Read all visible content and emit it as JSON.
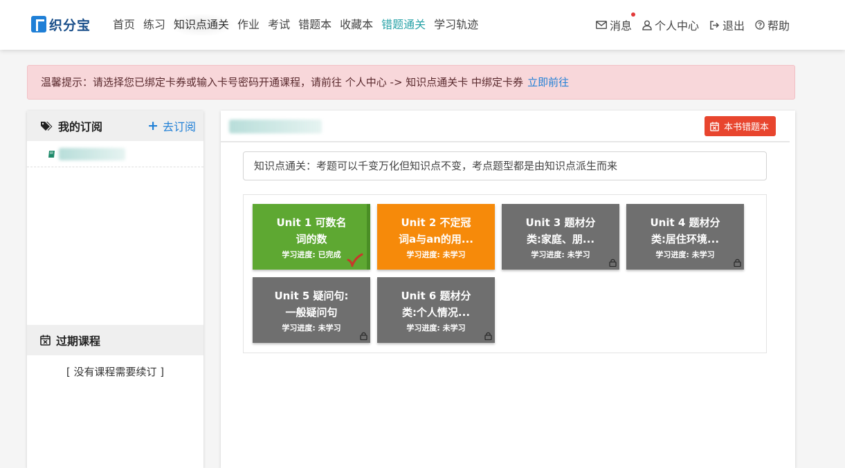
{
  "brand": {
    "name": "织分宝",
    "color": "#1f7fd6"
  },
  "nav": {
    "items": [
      {
        "label": "首页",
        "state": "normal"
      },
      {
        "label": "练习",
        "state": "normal"
      },
      {
        "label": "知识点通关",
        "state": "active"
      },
      {
        "label": "作业",
        "state": "normal"
      },
      {
        "label": "考试",
        "state": "normal"
      },
      {
        "label": "错题本",
        "state": "normal"
      },
      {
        "label": "收藏本",
        "state": "normal"
      },
      {
        "label": "错题通关",
        "state": "teal"
      },
      {
        "label": "学习轨迹",
        "state": "normal"
      }
    ],
    "right": {
      "messages": "消息",
      "profile": "个人中心",
      "logout": "退出",
      "help": "帮助"
    }
  },
  "alert": {
    "text": "温馨提示：请选择您已绑定卡券或输入卡号密码开通课程，请前往 个人中心 -> 知识点通关卡 中绑定卡券",
    "link": "立即前往"
  },
  "sidebar": {
    "subscriptions_title": "我的订阅",
    "subscribe_link": "去订阅",
    "expired_title": "过期课程",
    "expired_empty": "[ 没有课程需要续订 ]"
  },
  "main": {
    "error_book_button": "本书错题本",
    "info": "知识点通关：考题可以千变万化但知识点不变，考点题型都是由知识点派生而来",
    "units": [
      {
        "title_line1": "Unit 1 可数名",
        "title_line2": "词的数",
        "progress": "学习进度: 已完成",
        "status": "done"
      },
      {
        "title_line1": "Unit 2 不定冠",
        "title_line2": "词a与an的用...",
        "progress": "学习进度: 未学习",
        "status": "current"
      },
      {
        "title_line1": "Unit 3 题材分",
        "title_line2": "类:家庭、朋...",
        "progress": "学习进度: 未学习",
        "status": "locked"
      },
      {
        "title_line1": "Unit 4 题材分",
        "title_line2": "类:居住环境...",
        "progress": "学习进度: 未学习",
        "status": "locked"
      },
      {
        "title_line1": "Unit 5 疑问句:",
        "title_line2": "一般疑问句",
        "progress": "学习进度: 未学习",
        "status": "locked"
      },
      {
        "title_line1": "Unit 6 题材分",
        "title_line2": "类:个人情况...",
        "progress": "学习进度: 未学习",
        "status": "locked"
      }
    ],
    "colors": {
      "done": "#5ea832",
      "current": "#f68a0a",
      "locked": "#6f6f6f",
      "error_button": "#e8452e"
    }
  }
}
